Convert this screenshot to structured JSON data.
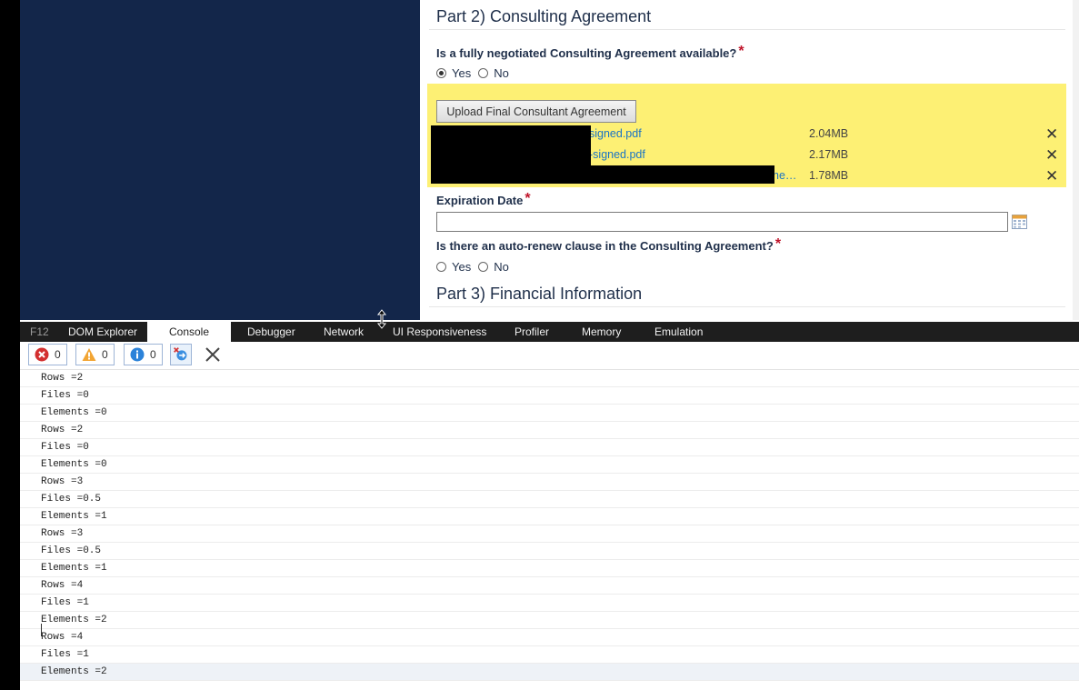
{
  "form": {
    "part2_title": "Part 2) Consulting Agreement",
    "q_agreement": "Is a fully negotiated Consulting Agreement available?",
    "required_mark": "*",
    "yes": "Yes",
    "no": "No",
    "agreement_answer": "Yes",
    "upload_button": "Upload Final Consultant Agreement",
    "files": [
      {
        "name": "signed.pdf",
        "size": "2.04MB",
        "remove": "✕"
      },
      {
        "name": "-signed.pdf",
        "size": "2.17MB",
        "remove": "✕"
      },
      {
        "name": "he…",
        "size": "1.78MB",
        "remove": "✕"
      }
    ],
    "expiration_label": "Expiration Date",
    "expiration_value": "",
    "q_autorenew": "Is there an auto-renew clause in the Consulting Agreement?",
    "part3_title": "Part 3) Financial Information"
  },
  "devtools": {
    "tabs": [
      "F12",
      "DOM Explorer",
      "Console",
      "Debugger",
      "Network",
      "UI Responsiveness",
      "Profiler",
      "Memory",
      "Emulation"
    ],
    "active_tab": "Console",
    "errors": "0",
    "warnings": "0",
    "messages": "0"
  },
  "console": {
    "lines": [
      "Rows =2",
      "Files =0",
      "Elements =0",
      "Rows =2",
      "Files =0",
      "Elements =0",
      "Rows =3",
      "Files =0.5",
      "Elements =1",
      "Rows =3",
      "Files =0.5",
      "Elements =1",
      "Rows =4",
      "Files =1",
      "Elements =2",
      "Rows =4",
      "Files =1",
      "Elements =2"
    ]
  },
  "colors": {
    "navy": "#13264a",
    "highlight": "#fdf074",
    "link": "#1b74c5",
    "required": "#c0142a"
  }
}
